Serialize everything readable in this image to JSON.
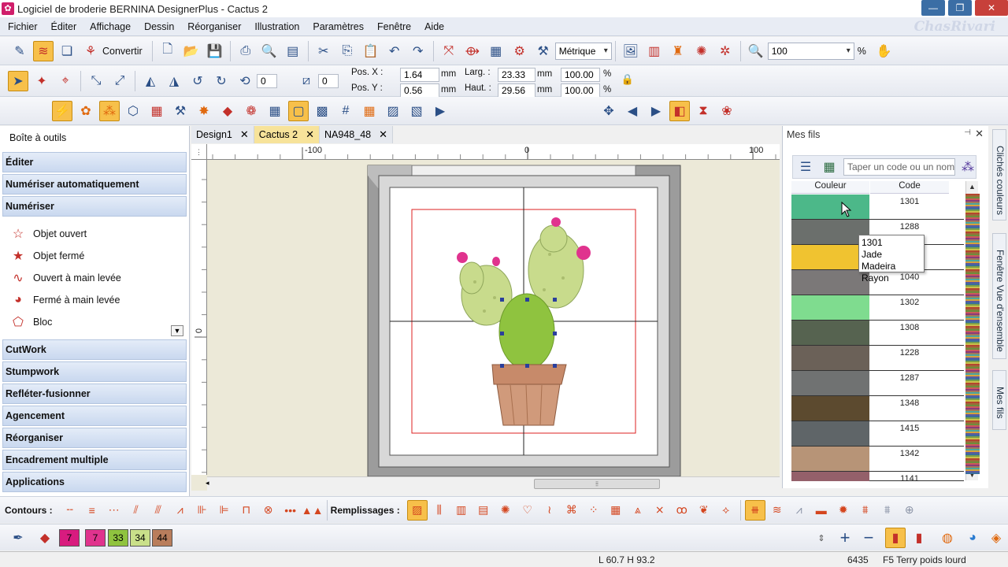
{
  "window": {
    "title": "Logiciel de broderie BERNINA DesignerPlus - Cactus 2"
  },
  "brand": "ChasRivari",
  "menu": [
    "Fichier",
    "Éditer",
    "Affichage",
    "Dessin",
    "Réorganiser",
    "Illustration",
    "Paramètres",
    "Fenêtre",
    "Aide"
  ],
  "toolbar": {
    "convert_label": "Convertir",
    "units_value": "Métrique",
    "zoom_value": "100",
    "zoom_unit": "%"
  },
  "transform": {
    "rotate_value": "0",
    "skew_value": "0",
    "pos_x_label": "Pos. X :",
    "pos_x_value": "1.64",
    "pos_y_label": "Pos. Y :",
    "pos_y_value": "0.56",
    "width_label": "Larg. :",
    "width_value": "23.33",
    "height_label": "Haut. :",
    "height_value": "29.56",
    "unit_mm": "mm",
    "scale_w": "100.00",
    "scale_h": "100.00",
    "unit_pct": "%"
  },
  "toolbox": {
    "title": "Boîte à outils",
    "groups_top": [
      "Éditer",
      "Numériser automatiquement",
      "Numériser"
    ],
    "tools": [
      "Objet ouvert",
      "Objet fermé",
      "Ouvert à main levée",
      "Fermé à main levée",
      "Bloc"
    ],
    "groups_bottom": [
      "CutWork",
      "Stumpwork",
      "Refléter-fusionner",
      "Agencement",
      "Réorganiser",
      "Encadrement multiple",
      "Applications"
    ]
  },
  "tabs": [
    {
      "label": "Design1",
      "active": false
    },
    {
      "label": "Cactus 2",
      "active": true
    },
    {
      "label": "NA948_48",
      "active": false
    }
  ],
  "rulers": {
    "h_labels": [
      "-100",
      "0",
      "100"
    ],
    "v_labels": [
      "0"
    ]
  },
  "threads_panel": {
    "title": "Mes fils",
    "search_placeholder": "Taper un code ou un nom",
    "col_color": "Couleur",
    "col_code": "Code",
    "rows": [
      {
        "color": "#4cb889",
        "code": "1301"
      },
      {
        "color": "#6b6f6c",
        "code": "1288"
      },
      {
        "color": "#f0c330",
        "code": ""
      },
      {
        "color": "#7b7878",
        "code": "1040"
      },
      {
        "color": "#7fdc8f",
        "code": "1302"
      },
      {
        "color": "#566350",
        "code": "1308"
      },
      {
        "color": "#6b6158",
        "code": "1228"
      },
      {
        "color": "#707272",
        "code": "1287"
      },
      {
        "color": "#5c4a2f",
        "code": "1348"
      },
      {
        "color": "#5f6568",
        "code": "1415"
      },
      {
        "color": "#b79477",
        "code": "1342"
      },
      {
        "color": "#94606a",
        "code": "1141"
      }
    ],
    "tooltip": {
      "code": "1301",
      "name": "Jade",
      "brand": "Madeira Rayon"
    }
  },
  "side_tabs": [
    "Clichés couleurs",
    "Fenêtre Vue d'ensemble",
    "Mes fils"
  ],
  "bottom_toolbar": {
    "contours_label": "Contours :",
    "fills_label": "Remplissages :"
  },
  "color_chips": [
    {
      "label": "7",
      "color": "#d81b7f"
    },
    {
      "label": "7",
      "color": "#e0338e"
    },
    {
      "label": "33",
      "color": "#8fc33f"
    },
    {
      "label": "34",
      "color": "#c9e08a"
    },
    {
      "label": "44",
      "color": "#b97d5c"
    }
  ],
  "status": {
    "dimensions": "L 60.7 H 93.2",
    "stitches": "6435",
    "fabric": "F5 Terry poids lourd"
  }
}
